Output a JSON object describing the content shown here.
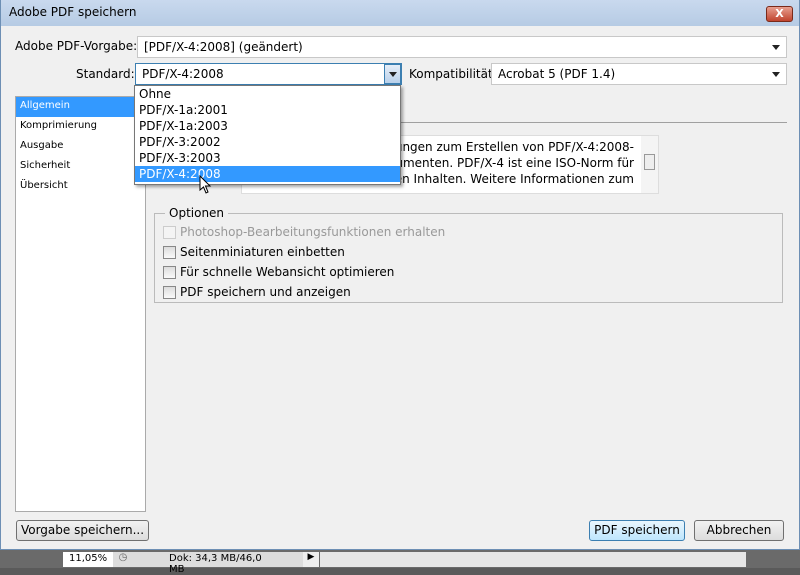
{
  "title": "Adobe PDF speichern",
  "close_label": "X",
  "preset": {
    "label": "Adobe PDF-Vorgabe:",
    "value": "[PDF/X-4:2008] (geändert)"
  },
  "standard": {
    "label": "Standard:",
    "value": "PDF/X-4:2008",
    "options": [
      "Ohne",
      "PDF/X-1a:2001",
      "PDF/X-1a:2003",
      "PDF/X-3:2002",
      "PDF/X-3:2003",
      "PDF/X-4:2008"
    ]
  },
  "compat": {
    "label": "Kompatibilität:",
    "value": "Acrobat 5 (PDF 1.4)"
  },
  "sidebar": [
    "Allgemein",
    "Komprimierung",
    "Ausgabe",
    "Sicherheit",
    "Übersicht"
  ],
  "description": [
    "llungen zum Erstellen von PDF/X-4:2008-",
    "kumenten. PDF/X-4 ist eine ISO-Norm für",
    "en Inhalten. Weitere Informationen zum"
  ],
  "options": {
    "title": "Optionen",
    "items": [
      "Photoshop-Bearbeitungsfunktionen erhalten",
      "Seitenminiaturen einbetten",
      "Für schnelle Webansicht optimieren",
      "PDF speichern und anzeigen"
    ]
  },
  "buttons": {
    "save_preset": "Vorgabe speichern...",
    "save_pdf": "PDF speichern",
    "cancel": "Abbrechen"
  },
  "statusbar": {
    "zoom": "11,05%",
    "doc": "Dok: 34,3 MB/46,0 MB"
  }
}
